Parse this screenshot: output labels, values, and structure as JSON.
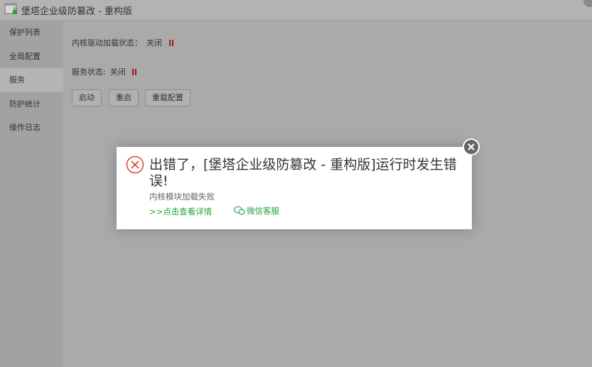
{
  "window": {
    "title": "堡塔企业级防篡改 - 重构版"
  },
  "sidebar": {
    "items": [
      {
        "label": "保护列表"
      },
      {
        "label": "全局配置"
      },
      {
        "label": "服务"
      },
      {
        "label": "防护统计"
      },
      {
        "label": "操作日志"
      }
    ],
    "active_index": 2
  },
  "main": {
    "driver_status_label": "内核驱动加载状态：",
    "driver_status_value": "关闭",
    "service_status_label": "服务状态:",
    "service_status_value": "关闭",
    "buttons": {
      "start": "启动",
      "restart": "重启",
      "reload": "重载配置"
    },
    "status_color": "#a31515"
  },
  "dialog": {
    "title": "出错了，[堡塔企业级防篡改 - 重构版]运行时发生错误!",
    "message": "内核模块加载失败",
    "detail_link": ">>点击查看详情",
    "support_link": "微信客服",
    "error_color": "#e0483a",
    "link_color": "#20a53a"
  }
}
